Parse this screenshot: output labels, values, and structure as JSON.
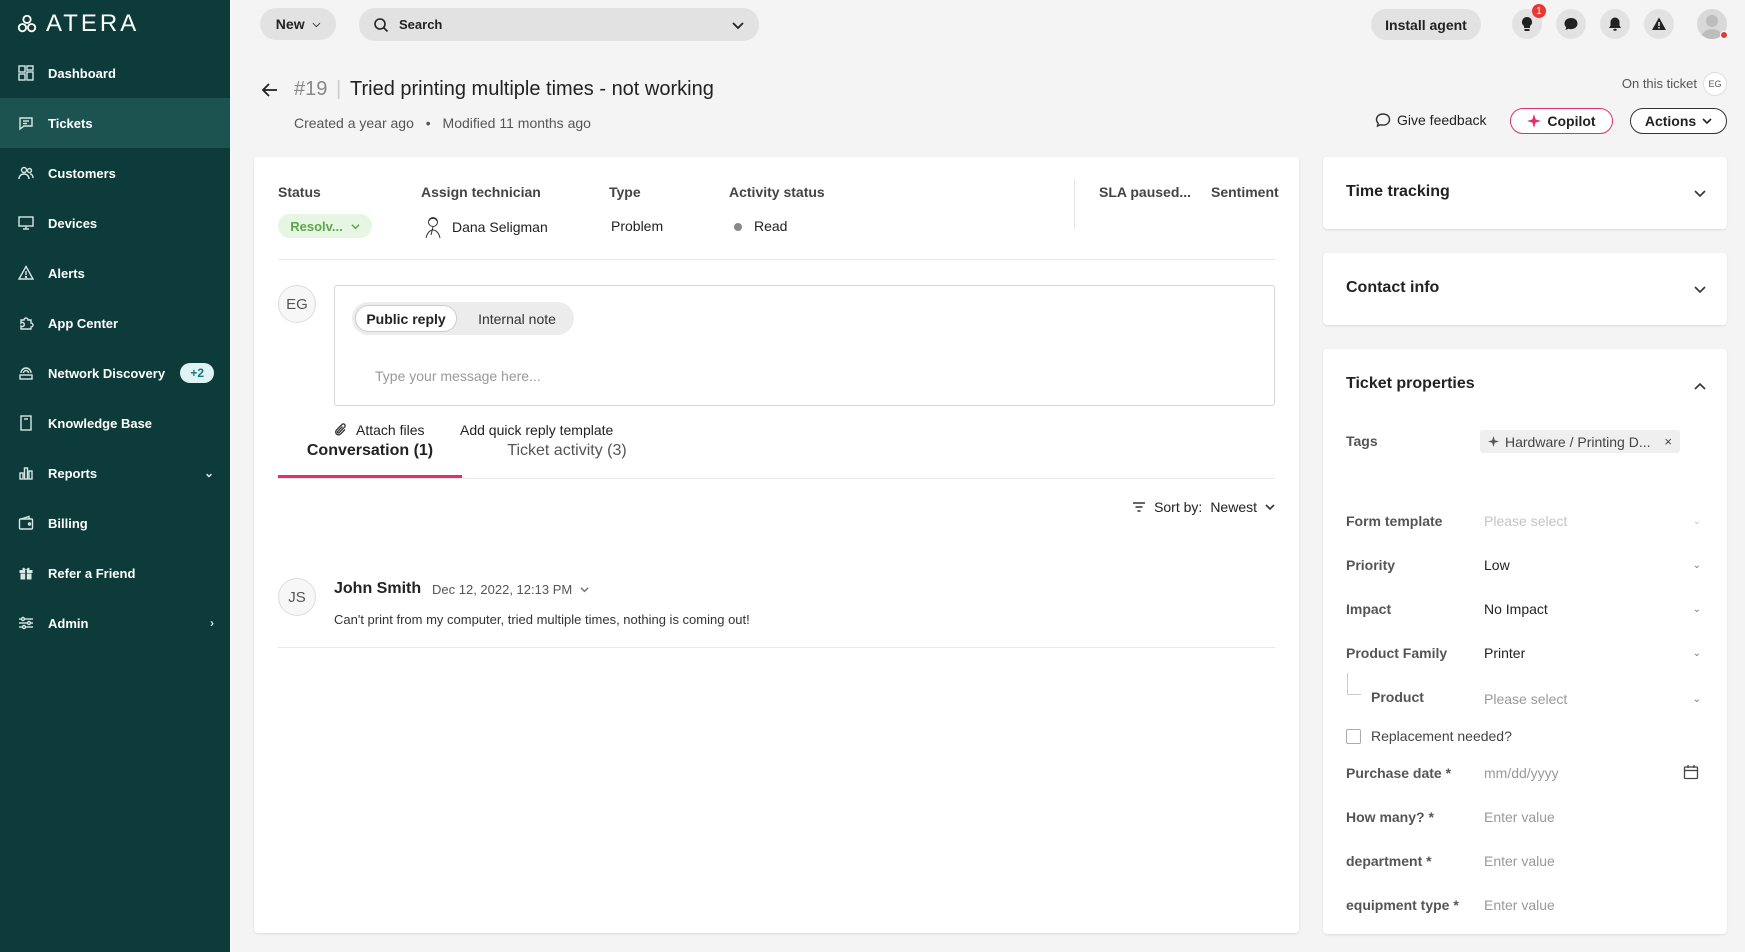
{
  "brand": {
    "name": "ATERA",
    "accent": "#e0306f",
    "sidebar_bg": "#0d3b3a"
  },
  "sidebar": {
    "items": [
      {
        "label": "Dashboard",
        "icon": "dashboard-icon"
      },
      {
        "label": "Tickets",
        "icon": "ticket-icon",
        "active": true
      },
      {
        "label": "Customers",
        "icon": "customers-icon"
      },
      {
        "label": "Devices",
        "icon": "monitor-icon"
      },
      {
        "label": "Alerts",
        "icon": "warning-icon"
      },
      {
        "label": "App Center",
        "icon": "puzzle-icon"
      },
      {
        "label": "Network Discovery",
        "icon": "network-icon",
        "badge": "+2"
      },
      {
        "label": "Knowledge Base",
        "icon": "book-icon"
      },
      {
        "label": "Reports",
        "icon": "bar-chart-icon"
      },
      {
        "label": "Billing",
        "icon": "wallet-icon"
      },
      {
        "label": "Refer a Friend",
        "icon": "gift-icon"
      },
      {
        "label": "Admin",
        "icon": "sliders-icon"
      }
    ]
  },
  "topbar": {
    "new_label": "New",
    "search_label": "Search",
    "install_label": "Install agent",
    "notification_count": "1"
  },
  "ticket": {
    "number": "#19",
    "title": "Tried printing multiple times - not working",
    "created": "Created a year ago",
    "modified": "Modified 11 months ago",
    "on_ticket_label": "On this ticket",
    "on_ticket_initials": "EG",
    "feedback_label": "Give feedback",
    "copilot_label": "Copilot",
    "actions_label": "Actions"
  },
  "fields": {
    "status_label": "Status",
    "status_value": "Resolv...",
    "tech_label": "Assign technician",
    "tech_value": "Dana Seligman",
    "type_label": "Type",
    "type_value": "Problem",
    "activity_label": "Activity status",
    "activity_value": "Read",
    "sla_label": "SLA paused...",
    "sentiment_label": "Sentiment"
  },
  "reply": {
    "avatar": "EG",
    "public_label": "Public reply",
    "internal_label": "Internal note",
    "placeholder": "Type your message here...",
    "attach_label": "Attach files",
    "quick_label": "Add quick reply template"
  },
  "tabs": {
    "conversation": "Conversation (1)",
    "activity": "Ticket activity (3)",
    "sort_prefix": "Sort by:",
    "sort_value": "Newest"
  },
  "messages": [
    {
      "initials": "JS",
      "author": "John Smith",
      "date": "Dec 12, 2022, 12:13 PM",
      "text": "Can't print from my computer, tried multiple times, nothing is coming out!"
    }
  ],
  "panels": {
    "time_tracking": "Time tracking",
    "contact_info": "Contact info",
    "ticket_properties": "Ticket properties"
  },
  "properties": {
    "tags_label": "Tags",
    "tag_value": "Hardware / Printing D...",
    "form_template_label": "Form template",
    "form_template_placeholder": "Please select",
    "priority_label": "Priority",
    "priority_value": "Low",
    "impact_label": "Impact",
    "impact_value": "No Impact",
    "product_family_label": "Product Family",
    "product_family_value": "Printer",
    "product_label": "Product",
    "product_placeholder": "Please select",
    "replacement_label": "Replacement needed?",
    "purchase_label": "Purchase date *",
    "purchase_placeholder": "mm/dd/yyyy",
    "how_many_label": "How many? *",
    "how_many_placeholder": "Enter value",
    "department_label": "department *",
    "department_placeholder": "Enter value",
    "equipment_label": "equipment type *",
    "equipment_placeholder": "Enter value"
  }
}
